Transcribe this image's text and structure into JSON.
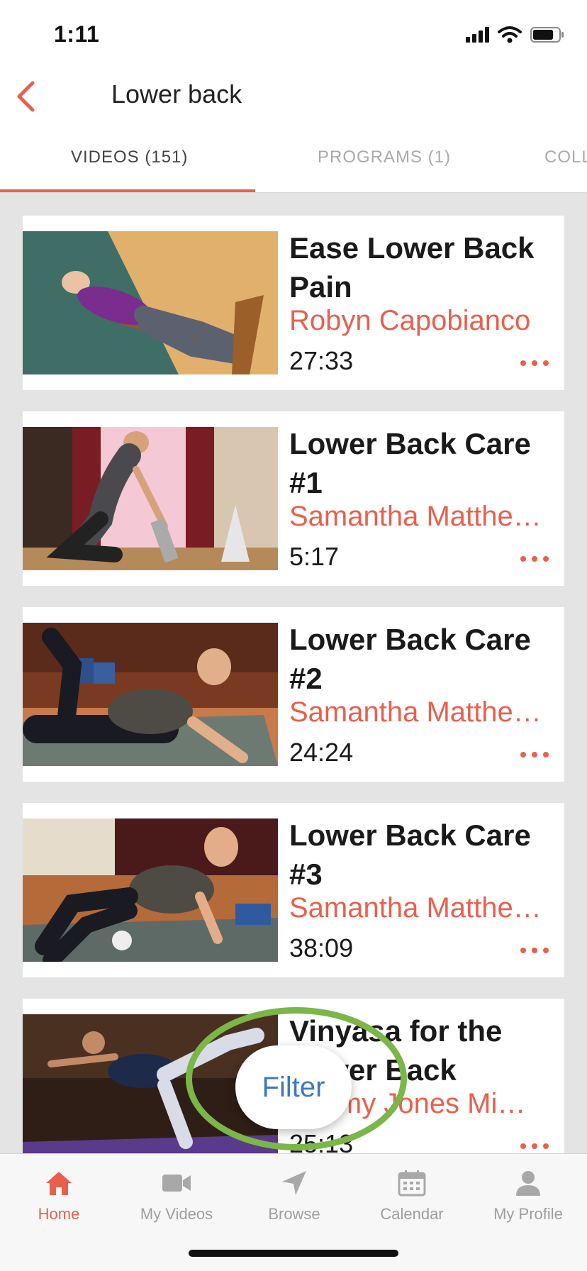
{
  "status_bar": {
    "time": "1:11"
  },
  "header": {
    "title": "Lower back",
    "back_icon": "chevron-left-icon"
  },
  "tabs": [
    {
      "label": "VIDEOS (151)",
      "active": true
    },
    {
      "label": "PROGRAMS (1)",
      "active": false
    },
    {
      "label": "COLLECTIONS",
      "active": false
    }
  ],
  "videos": [
    {
      "title": "Ease Lower Back Pain",
      "instructor": "Robyn Capobianco",
      "duration": "27:33"
    },
    {
      "title": "Lower Back Care #1",
      "instructor": "Samantha Matthews",
      "duration": "5:17"
    },
    {
      "title": "Lower Back Care #2",
      "instructor": "Samantha Matthews",
      "duration": "24:24"
    },
    {
      "title": "Lower Back Care #3",
      "instructor": "Samantha Matthews",
      "duration": "38:09"
    },
    {
      "title": "Vinyasa for the Lower Back",
      "instructor": "Kimmy Jones Mi…",
      "duration": "25:13"
    }
  ],
  "filter": {
    "label": "Filter"
  },
  "bottom_nav": [
    {
      "label": "Home",
      "icon": "home-icon",
      "active": true
    },
    {
      "label": "My Videos",
      "icon": "video-camera-icon",
      "active": false
    },
    {
      "label": "Browse",
      "icon": "navigation-arrow-icon",
      "active": false
    },
    {
      "label": "Calendar",
      "icon": "calendar-icon",
      "active": false
    },
    {
      "label": "My Profile",
      "icon": "profile-icon",
      "active": false
    }
  ],
  "colors": {
    "accent": "#e8604c",
    "filter_text": "#3d7ab8",
    "highlight_ring": "#7ab648",
    "list_background": "#e4e4e4"
  }
}
